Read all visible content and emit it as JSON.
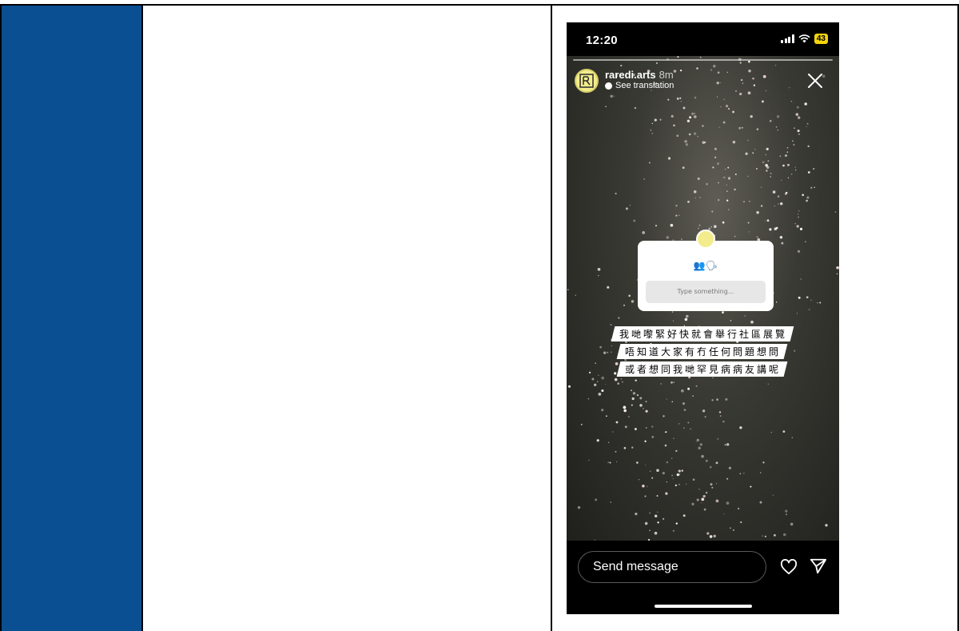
{
  "status_bar": {
    "time": "12:20",
    "battery": "43"
  },
  "story": {
    "username": "raredi.arts",
    "age": "8m",
    "see_translation": "See translation",
    "question_emoji": "👥🗣",
    "question_placeholder": "Type something...",
    "caption_lines": [
      "我哋嚟緊好快就會舉行社區展覽",
      "唔知道大家有冇任何問題想問",
      "或者想同我哋罕見病病友講呢"
    ]
  },
  "reply_bar": {
    "send_message_placeholder": "Send message"
  },
  "colors": {
    "left_column": "#0a4f92",
    "battery_badge": "#f4d30b"
  }
}
